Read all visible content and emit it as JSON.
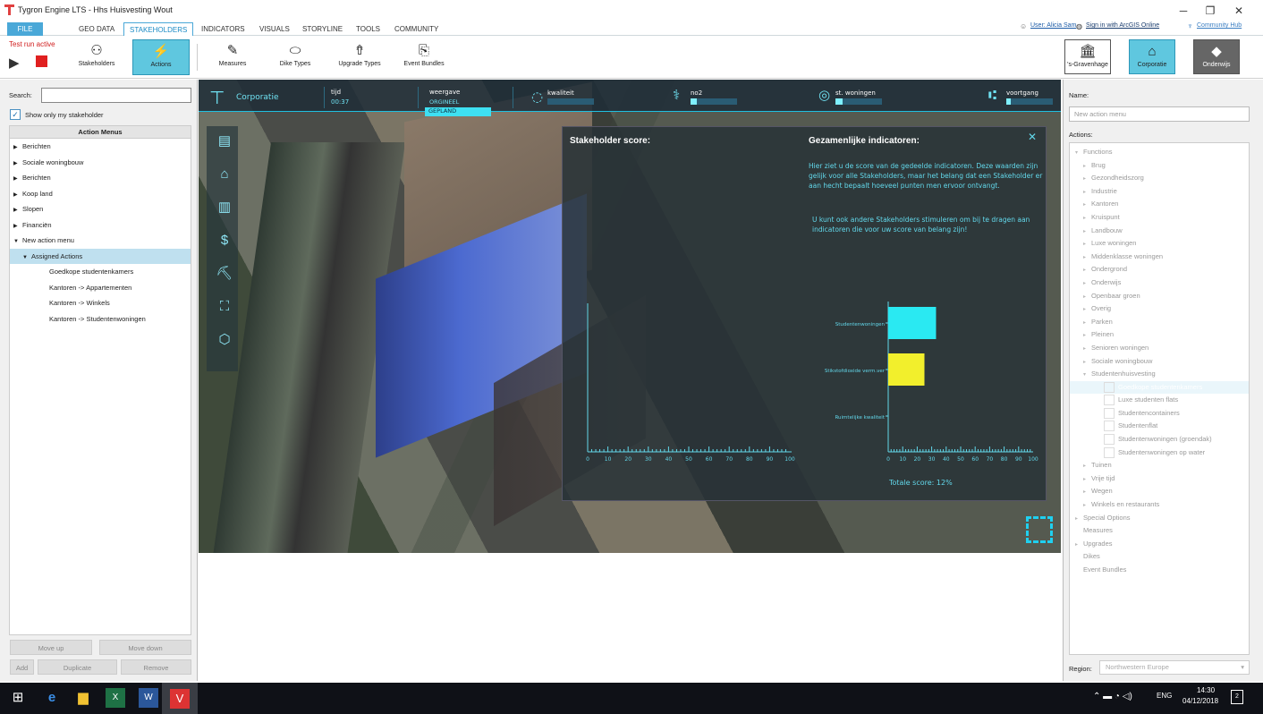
{
  "window": {
    "title": "Tygron Engine LTS - Hhs Huisvesting Wout"
  },
  "menu": {
    "file": "FILE",
    "tabs": [
      "GEO DATA",
      "STAKEHOLDERS",
      "INDICATORS",
      "VISUALS",
      "STORYLINE",
      "TOOLS",
      "COMMUNITY"
    ],
    "active_tab": "STAKEHOLDERS"
  },
  "header_right": {
    "user": "User: Alicia Sam",
    "arcgis": "Sign in with ArcGIS Online",
    "hub": "Community Hub"
  },
  "ribbon": {
    "test_run": "Test run active",
    "buttons": [
      "Stakeholders",
      "Actions",
      "Measures",
      "Dike Types",
      "Upgrade Types",
      "Event Bundles"
    ],
    "selected": "Actions"
  },
  "stakeholders": [
    "'s-Gravenhage",
    "Corporatie",
    "Onderwijs"
  ],
  "left": {
    "search_label": "Search:",
    "search_value": "",
    "show_only": "Show only my stakeholder",
    "tree_header": "Action Menus",
    "items": [
      {
        "label": "Berichten",
        "level": 0,
        "expanded": false
      },
      {
        "label": "Sociale woningbouw",
        "level": 0,
        "expanded": false
      },
      {
        "label": "Berichten",
        "level": 0,
        "expanded": false
      },
      {
        "label": "Koop land",
        "level": 0,
        "expanded": false
      },
      {
        "label": "Slopen",
        "level": 0,
        "expanded": false
      },
      {
        "label": "Financiën",
        "level": 0,
        "expanded": false
      },
      {
        "label": "New action menu",
        "level": 0,
        "expanded": true
      },
      {
        "label": "Assigned Actions",
        "level": 1,
        "expanded": true
      },
      {
        "label": "Goedkope studentenkamers",
        "level": 2
      },
      {
        "label": "Kantoren -> Appartementen",
        "level": 2
      },
      {
        "label": "Kantoren -> Winkels",
        "level": 2
      },
      {
        "label": "Kantoren -> Studentenwoningen",
        "level": 2
      }
    ],
    "buttons": {
      "move_up": "Move up",
      "move_down": "Move down",
      "add": "Add",
      "duplicate": "Duplicate",
      "remove": "Remove"
    }
  },
  "hud": {
    "stakeholder": "Corporatie",
    "tijd_label": "tijd",
    "tijd_value": "00:37",
    "weergave_label": "weergave",
    "weergave_origineel": "ORGINEEL",
    "weergave_gepland": "GEPLAND",
    "indicators": [
      {
        "label": "kwaliteit",
        "level": 0
      },
      {
        "label": "no2",
        "level": 0.14
      },
      {
        "label": "st. woningen",
        "level": 0.16
      },
      {
        "label": "voortgang",
        "level": 0.1
      }
    ]
  },
  "overlay": {
    "left_title": "Stakeholder score:",
    "right_title": "Gezamenlijke indicatoren:",
    "para1": "Hier ziet u de score van de gedeelde indicatoren. Deze waarden zijn gelijk voor alle Stakeholders, maar het belang dat een Stakeholder er aan hecht bepaalt hoeveel punten men ervoor ontvangt.",
    "para2": "U kunt ook andere Stakeholders stimuleren om bij te dragen aan indicatoren die voor uw score van belang zijn!",
    "total": "Totale score: 12%",
    "ticks": [
      "0",
      "10",
      "20",
      "30",
      "40",
      "50",
      "60",
      "70",
      "80",
      "90",
      "100"
    ],
    "close": "✕"
  },
  "chart_data": {
    "type": "bar",
    "categories": [
      "Studentenwoningen",
      "Stikstofdioxide verm.ver",
      "Ruimtelijke kwaliteit"
    ],
    "values": [
      33,
      25,
      0
    ],
    "colors": [
      "#2ae9f2",
      "#f2ef2c",
      "#ffffff"
    ],
    "xlim": [
      0,
      100
    ],
    "xticks": [
      0,
      10,
      20,
      30,
      40,
      50,
      60,
      70,
      80,
      90,
      100
    ]
  },
  "right": {
    "name_label": "Name:",
    "name_placeholder": "New action menu",
    "actions_label": "Actions:",
    "region_label": "Region:",
    "region_value": "Northwestern Europe",
    "rows": [
      {
        "label": "Functions",
        "level": 0,
        "tri": "▾"
      },
      {
        "label": "Brug",
        "level": 1,
        "tri": "▸"
      },
      {
        "label": "Gezondheidszorg",
        "level": 1,
        "tri": "▸"
      },
      {
        "label": "Industrie",
        "level": 1,
        "tri": "▸"
      },
      {
        "label": "Kantoren",
        "level": 1,
        "tri": "▸"
      },
      {
        "label": "Kruispunt",
        "level": 1,
        "tri": "▸"
      },
      {
        "label": "Landbouw",
        "level": 1,
        "tri": "▸"
      },
      {
        "label": "Luxe woningen",
        "level": 1,
        "tri": "▸"
      },
      {
        "label": "Middenklasse woningen",
        "level": 1,
        "tri": "▸"
      },
      {
        "label": "Ondergrond",
        "level": 1,
        "tri": "▸"
      },
      {
        "label": "Onderwijs",
        "level": 1,
        "tri": "▸"
      },
      {
        "label": "Openbaar groen",
        "level": 1,
        "tri": "▸"
      },
      {
        "label": "Overig",
        "level": 1,
        "tri": "▸"
      },
      {
        "label": "Parken",
        "level": 1,
        "tri": "▸"
      },
      {
        "label": "Pleinen",
        "level": 1,
        "tri": "▸"
      },
      {
        "label": "Senioren woningen",
        "level": 1,
        "tri": "▸"
      },
      {
        "label": "Sociale woningbouw",
        "level": 1,
        "tri": "▸"
      },
      {
        "label": "Studentenhuisvesting",
        "level": 1,
        "tri": "▾"
      },
      {
        "label": "Goedkope studentenkamers",
        "level": 2,
        "box": true,
        "sel": true
      },
      {
        "label": "Luxe studenten flats",
        "level": 2,
        "box": true
      },
      {
        "label": "Studentencontainers",
        "level": 2,
        "box": true
      },
      {
        "label": "Studentenflat",
        "level": 2,
        "box": true
      },
      {
        "label": "Studentenwoningen (groendak)",
        "level": 2,
        "box": true
      },
      {
        "label": "Studentenwoningen op water",
        "level": 2,
        "box": true
      },
      {
        "label": "Tuinen",
        "level": 1,
        "tri": "▸"
      },
      {
        "label": "Vrije tijd",
        "level": 1,
        "tri": "▸"
      },
      {
        "label": "Wegen",
        "level": 1,
        "tri": "▸"
      },
      {
        "label": "Winkels en restaurants",
        "level": 1,
        "tri": "▸"
      },
      {
        "label": "Special Options",
        "level": 0,
        "tri": "▸"
      },
      {
        "label": "Measures",
        "level": 0,
        "tri": ""
      },
      {
        "label": "Upgrades",
        "level": 0,
        "tri": "▸"
      },
      {
        "label": "Dikes",
        "level": 0,
        "tri": ""
      },
      {
        "label": "Event Bundles",
        "level": 0,
        "tri": ""
      }
    ]
  },
  "taskbar": {
    "lang": "ENG",
    "time": "14:30",
    "date": "04/12/2018",
    "notif": "2"
  }
}
